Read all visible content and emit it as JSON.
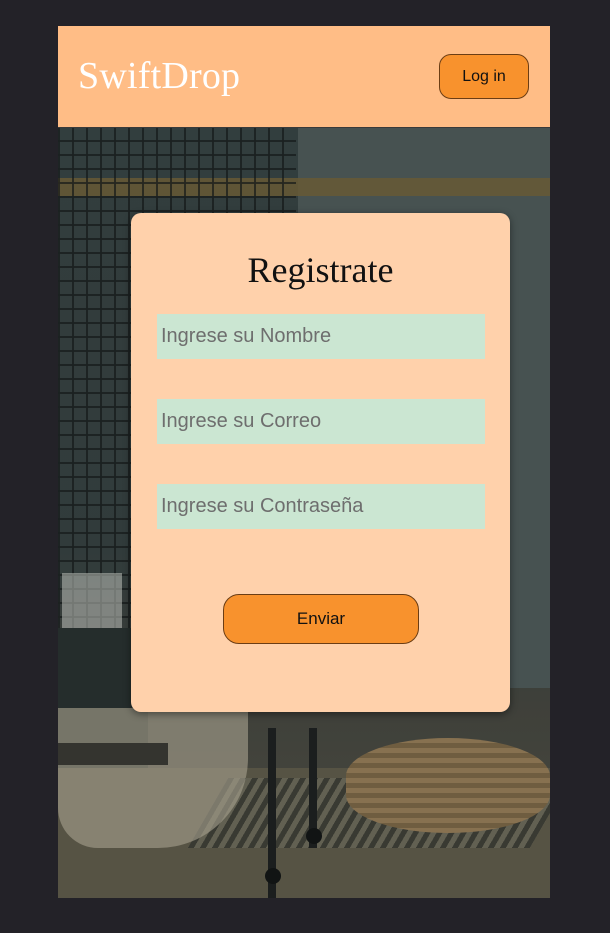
{
  "header": {
    "brand": "SwiftDrop",
    "login_label": "Log in"
  },
  "form": {
    "title": "Registrate",
    "name_placeholder": "Ingrese su Nombre",
    "email_placeholder": "Ingrese su Correo",
    "password_placeholder": "Ingrese su Contraseña",
    "submit_label": "Enviar"
  },
  "colors": {
    "page_background": "#232228",
    "header_background": "#ffbd86",
    "card_background": "#ffd1ab",
    "input_background": "#cbe6d2",
    "button_accent": "#f8922d"
  }
}
